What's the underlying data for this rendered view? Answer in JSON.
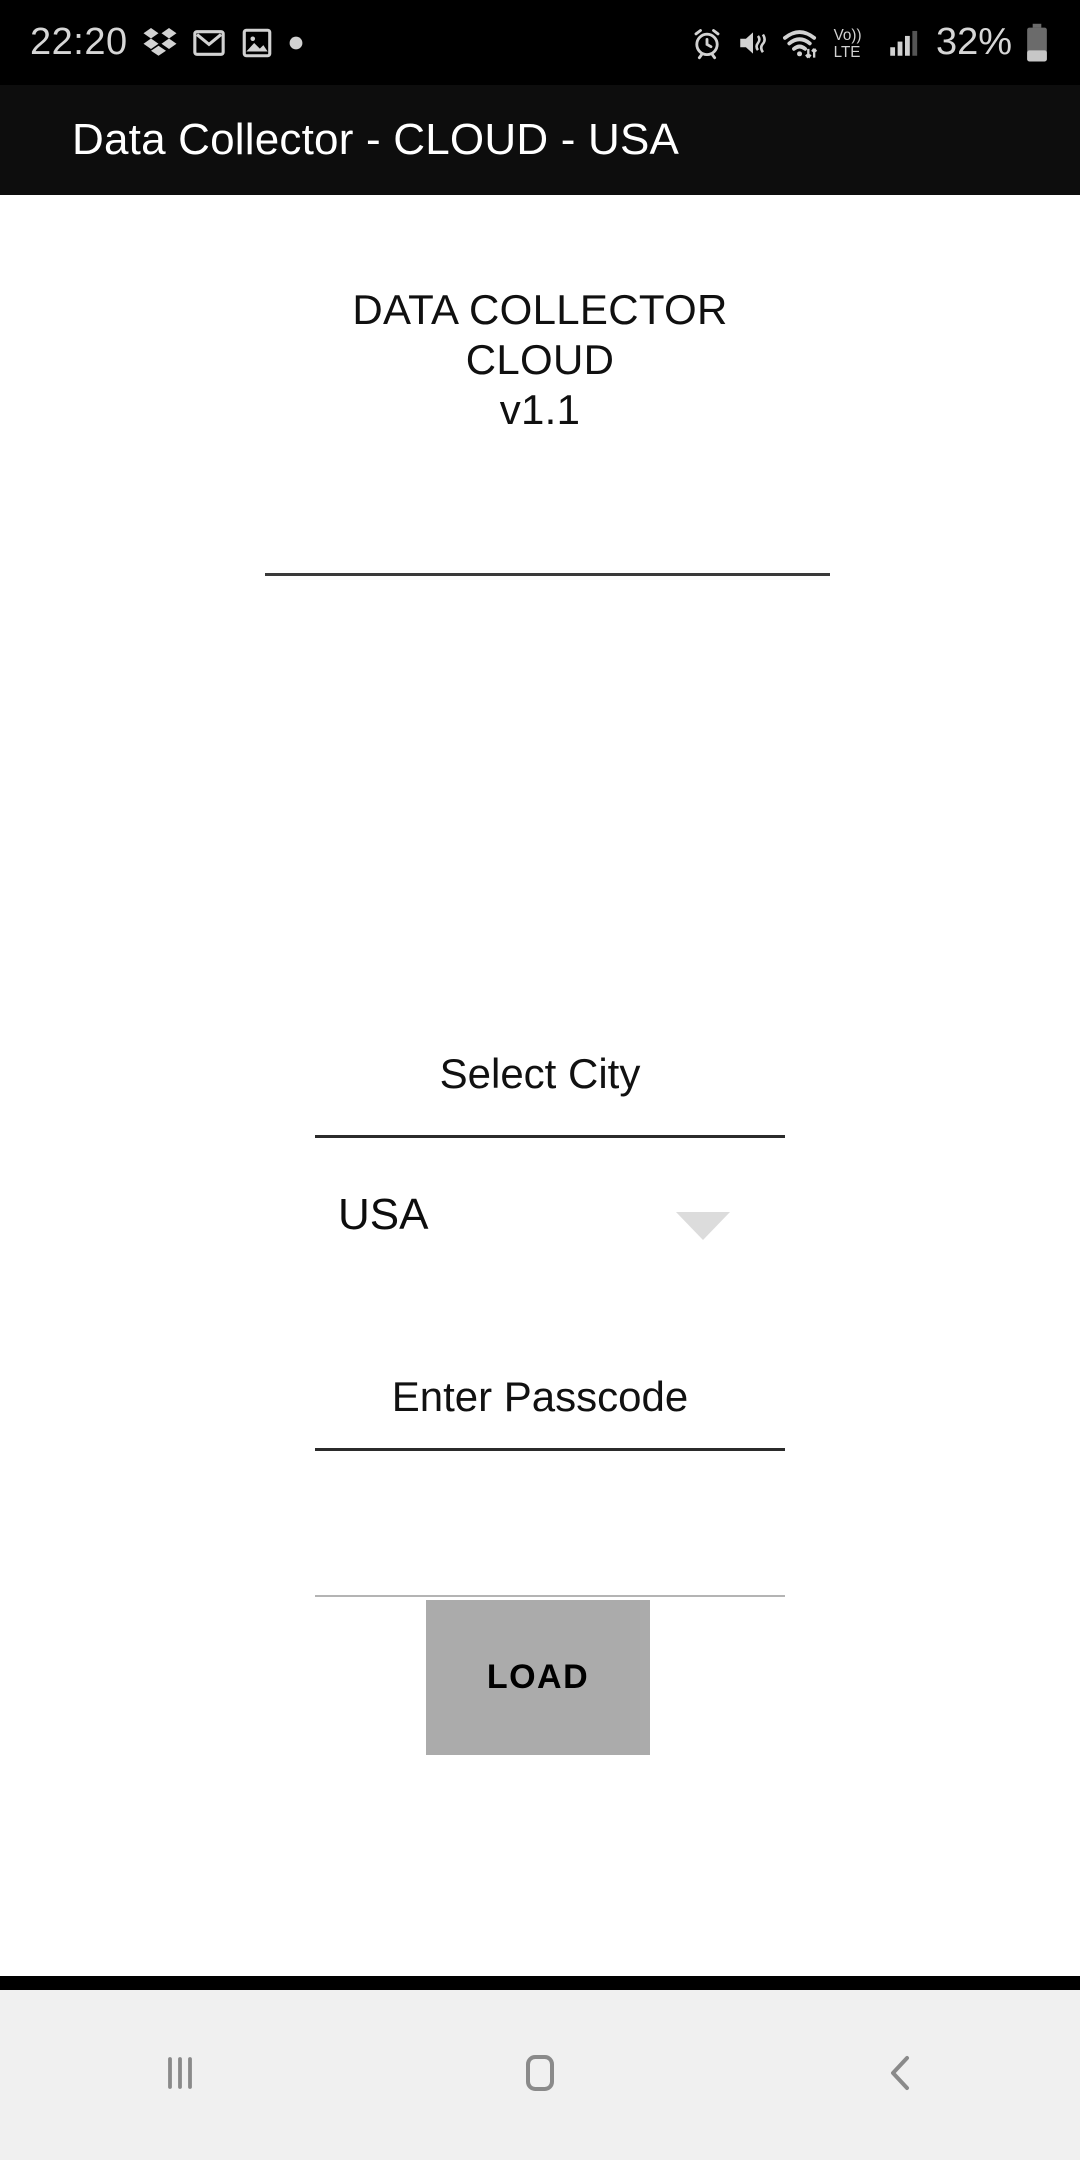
{
  "status_bar": {
    "time": "22:20",
    "battery_percent": "32%",
    "left_icons": [
      {
        "name": "dropbox-icon"
      },
      {
        "name": "gmail-icon"
      },
      {
        "name": "gallery-icon"
      },
      {
        "name": "dot-indicator-icon"
      }
    ],
    "right_icons": [
      {
        "name": "alarm-icon"
      },
      {
        "name": "vibrate-mute-icon"
      },
      {
        "name": "wifi-icon"
      },
      {
        "name": "volte-icon",
        "label_top": "Vo))",
        "label_bottom": "LTE"
      },
      {
        "name": "cellular-signal-icon"
      },
      {
        "name": "battery-icon"
      }
    ],
    "background_color": "#000000",
    "foreground_color": "#d6d6d6"
  },
  "app_bar": {
    "title": "Data Collector - CLOUD - USA",
    "background_color": "#0d0d0d",
    "text_color": "#ffffff"
  },
  "header": {
    "line1": "DATA COLLECTOR",
    "line2": "CLOUD",
    "line3": "v1.1"
  },
  "form": {
    "city_label": "Select City",
    "city_value": "USA",
    "city_options": [
      "USA"
    ],
    "passcode_label": "Enter Passcode",
    "passcode_value": "",
    "extra_field_value": "",
    "load_button_label": "LOAD",
    "load_button_color": "#ababab"
  },
  "nav_bar": {
    "background_color": "#f0f0f0",
    "icon_color": "#8a8a8a",
    "buttons": [
      {
        "name": "recents-icon",
        "label": "Recents"
      },
      {
        "name": "home-icon",
        "label": "Home"
      },
      {
        "name": "back-icon",
        "label": "Back"
      }
    ]
  }
}
